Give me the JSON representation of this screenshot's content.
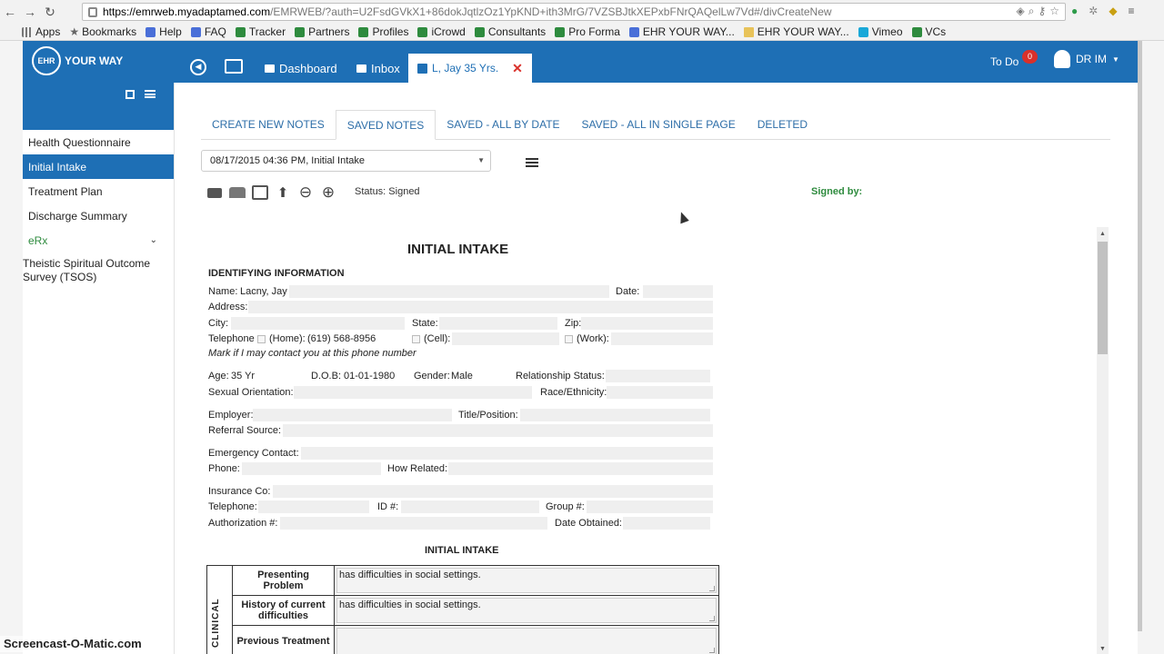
{
  "browser": {
    "url_host": "https://emrweb.myadaptamed.com",
    "url_path": "/EMRWEB/?auth=U2FsdGVkX1+86dokJqtlzOz1YpKND+ith3MrG/7VZSBJtkXEPxbFNrQAQelLw7Vd#/divCreateNew",
    "bookmarks": [
      {
        "label": "Apps",
        "icon": "grid"
      },
      {
        "label": "Bookmarks",
        "icon": "star"
      },
      {
        "label": "Help",
        "icon": "blue"
      },
      {
        "label": "FAQ",
        "icon": "blue"
      },
      {
        "label": "Tracker",
        "icon": "green"
      },
      {
        "label": "Partners",
        "icon": "green"
      },
      {
        "label": "Profiles",
        "icon": "green"
      },
      {
        "label": "iCrowd",
        "icon": "green"
      },
      {
        "label": "Consultants",
        "icon": "green"
      },
      {
        "label": "Pro Forma",
        "icon": "green"
      },
      {
        "label": "EHR YOUR WAY...",
        "icon": "blue"
      },
      {
        "label": "EHR YOUR WAY...",
        "icon": "folder"
      },
      {
        "label": "Vimeo",
        "icon": "teal"
      },
      {
        "label": "VCs",
        "icon": "green"
      }
    ]
  },
  "app": {
    "logo_mark": "EHR",
    "logo_text": "YOUR WAY",
    "nav_dashboard": "Dashboard",
    "nav_inbox": "Inbox",
    "patient_tab": "L, Jay 35 Yrs.",
    "todo_label": "To Do",
    "todo_count": "0",
    "user_name": "DR IM",
    "accent_color": "#1e6fb5"
  },
  "sidebar": {
    "items": [
      {
        "label": "Health Questionnaire",
        "active": false
      },
      {
        "label": "Initial Intake",
        "active": true
      },
      {
        "label": "Treatment Plan",
        "active": false
      },
      {
        "label": "Discharge Summary",
        "active": false
      },
      {
        "label": "eRx",
        "active": false
      },
      {
        "label": "Theistic Spiritual Outcome Survey (TSOS)",
        "active": false
      }
    ]
  },
  "tabs": [
    {
      "label": "CREATE NEW NOTES",
      "active": false
    },
    {
      "label": "SAVED NOTES",
      "active": true
    },
    {
      "label": "SAVED - ALL BY DATE",
      "active": false
    },
    {
      "label": "SAVED - ALL IN SINGLE PAGE",
      "active": false
    },
    {
      "label": "DELETED",
      "active": false
    }
  ],
  "note_select": "08/17/2015 04:36 PM, Initial Intake",
  "status_text": "Status: Signed",
  "signed_by_label": "Signed by:",
  "doc": {
    "title": "INITIAL INTAKE",
    "section_identifying": "IDENTIFYING INFORMATION",
    "name_label": "Name:",
    "name_value": "Lacny, Jay",
    "date_label": "Date:",
    "address_label": "Address:",
    "city_label": "City:",
    "state_label": "State:",
    "zip_label": "Zip:",
    "telephone_label": "Telephone",
    "home_label": "(Home):",
    "home_value": "(619) 568-8956",
    "cell_label": "(Cell):",
    "work_label": "(Work):",
    "contact_note": "Mark if I may contact you at this phone number",
    "age_label": "Age:",
    "age_value": "35 Yr",
    "dob_label": "D.O.B:",
    "dob_value": "01-01-1980",
    "gender_label": "Gender:",
    "gender_value": "Male",
    "relationship_label": "Relationship Status:",
    "orientation_label": "Sexual Orientation:",
    "race_label": "Race/Ethnicity:",
    "employer_label": "Employer:",
    "title_position_label": "Title/Position:",
    "referral_label": "Referral Source:",
    "emergency_label": "Emergency Contact:",
    "phone_label": "Phone:",
    "how_related_label": "How Related:",
    "insurance_label": "Insurance Co:",
    "ins_telephone_label": "Telephone:",
    "id_label": "ID #:",
    "group_label": "Group #:",
    "authorization_label": "Authorization #:",
    "date_obtained_label": "Date Obtained:",
    "subsection_title": "INITIAL INTAKE",
    "clinical_label": "CLINICAL",
    "presenting_label": "Presenting Problem",
    "presenting_value": "has difficulties in social settings.",
    "history_label": "History of current difficulties",
    "history_value": "has difficulties in social settings.",
    "previous_label": "Previous Treatment",
    "previous_value": ""
  },
  "watermark": "Screencast-O-Matic.com"
}
